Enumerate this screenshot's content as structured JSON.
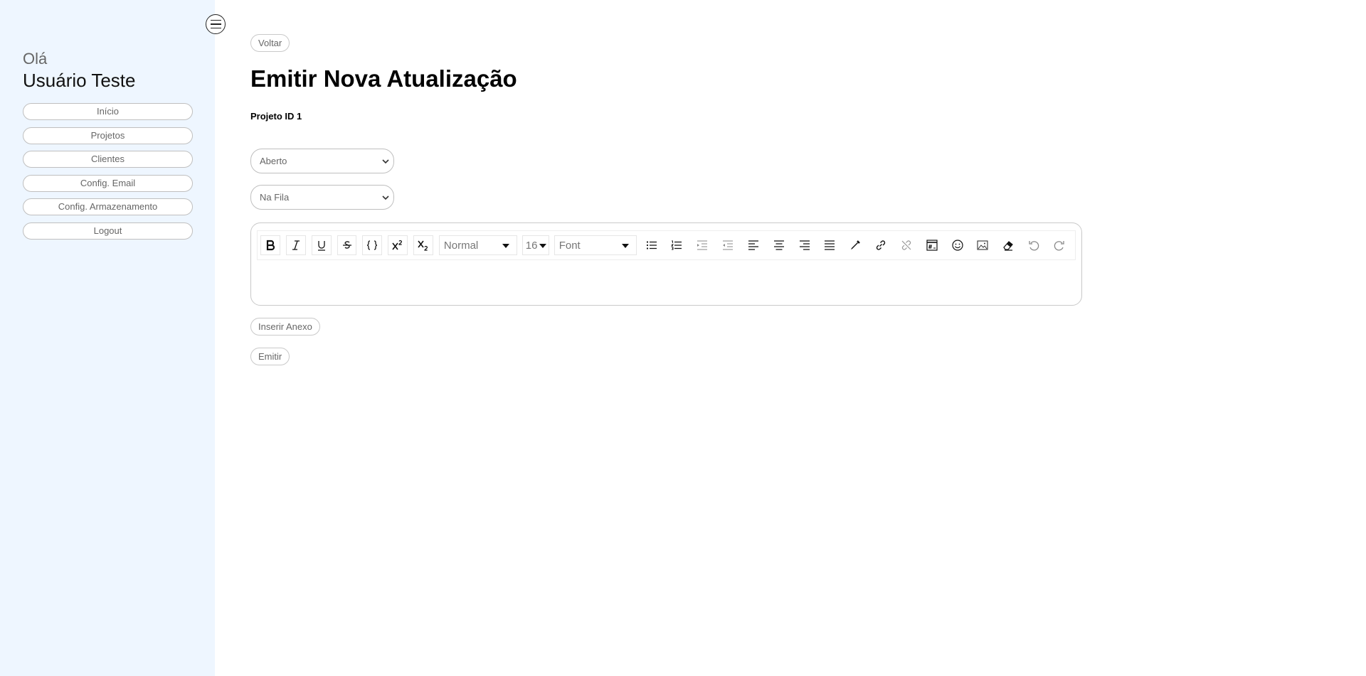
{
  "sidebar": {
    "greeting": "Olá",
    "user_name": "Usuário Teste",
    "items": [
      {
        "label": "Início"
      },
      {
        "label": "Projetos"
      },
      {
        "label": "Clientes"
      },
      {
        "label": "Config. Email"
      },
      {
        "label": "Config. Armazenamento"
      }
    ],
    "logout_label": "Logout"
  },
  "main": {
    "back_label": "Voltar",
    "title": "Emitir Nova Atualização",
    "project_label": "Projeto ID 1",
    "status_select": {
      "value": "Aberto"
    },
    "queue_select": {
      "value": "Na Fila"
    },
    "editor": {
      "heading_value": "Normal",
      "size_value": "16",
      "font_value": "Font",
      "content": ""
    },
    "attach_label": "Inserir Anexo",
    "emit_label": "Emitir"
  },
  "icons": {
    "menu_toggle": "hamburger-menu-icon"
  }
}
